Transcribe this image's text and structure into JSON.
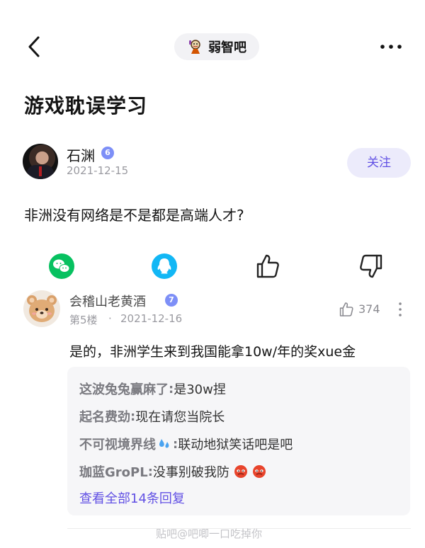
{
  "header": {
    "forum_name": "弱智吧"
  },
  "post": {
    "title": "游戏耽误学习",
    "author": {
      "name": "石渊",
      "level": "6",
      "date": "2021-12-15"
    },
    "follow_label": "关注",
    "body": "非洲没有网络是不是都是高端人才?"
  },
  "actions": [
    "wechat-icon",
    "qq-icon",
    "like-icon",
    "dislike-icon"
  ],
  "comment": {
    "user": "会稽山老黄酒",
    "level": "7",
    "floor": "第5楼",
    "separator": "·",
    "date": "2021-12-16",
    "likes": "374",
    "body": "是的，非洲学生来到我国能拿10w/年的奖xue金",
    "replies": [
      {
        "user": "这波兔兔赢麻了",
        "sep": ": ",
        "text": "是30w捏"
      },
      {
        "user": "起名费劲",
        "sep": ": ",
        "text": "现在请您当院长"
      },
      {
        "user": "不可视境界线",
        "sep": ": ",
        "text": "联动地狱笑话吧是吧"
      },
      {
        "user": "珈蓝GroPL",
        "sep": ": ",
        "text": "没事别破我防"
      }
    ],
    "view_all": "查看全部14条回复"
  },
  "watermark": "贴吧@吧唧一口吃掉你",
  "colors": {
    "accent": "#6150e4",
    "follow_bg": "#ecebfb",
    "level_badge": "#7d8ff7",
    "wechat": "#07c160",
    "qq": "#12b7f5"
  }
}
